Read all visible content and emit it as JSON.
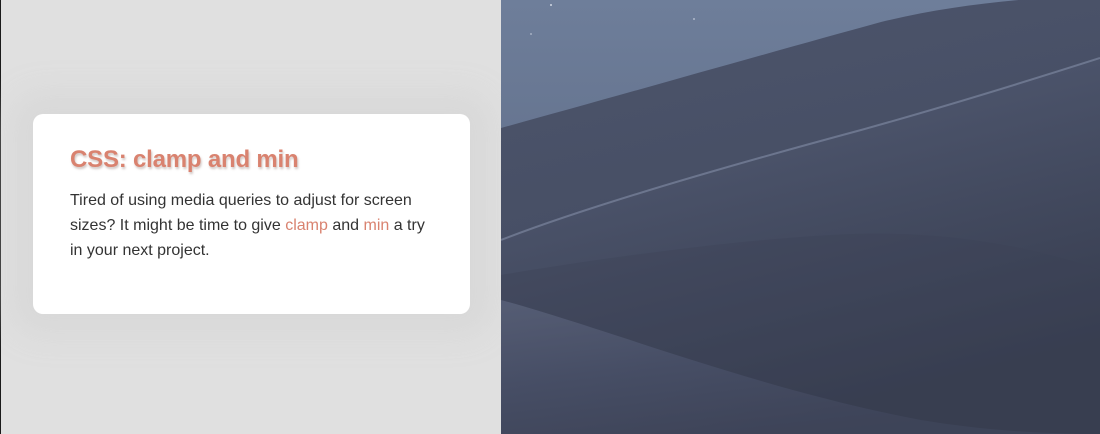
{
  "card": {
    "title": "CSS: clamp and min",
    "body": {
      "part1": "Tired of using media queries to adjust for screen sizes? It might be time to give ",
      "code1": "clamp",
      "part2": " and ",
      "code2": "min",
      "part3": " a try in your next project."
    }
  },
  "colors": {
    "accent": "#d9826f",
    "left_background": "#e0e0e0",
    "card_background": "#ffffff",
    "body_text": "#333333"
  },
  "background_image": {
    "subject": "dunes-at-dusk-photo"
  }
}
